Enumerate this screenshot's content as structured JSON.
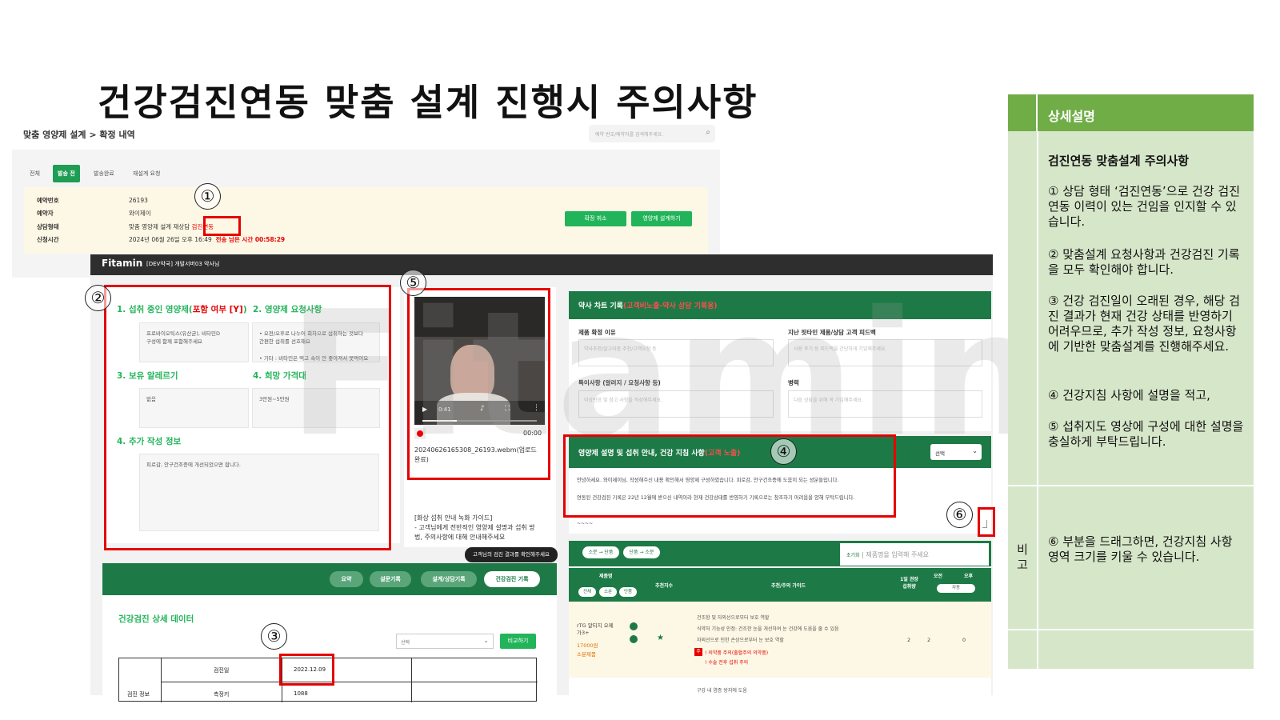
{
  "slide_title": "건강검진연동 맞춤 설계 진행시 주의사항",
  "admin": {
    "breadcrumb": "맞춤 영양제 설계 > 확정 내역",
    "search_placeholder": "예약 번호/예약자를 검색해주세요.",
    "tabs": [
      "전체",
      "발송 전",
      "발송완료",
      "재설계 요청"
    ],
    "rows": [
      {
        "label": "예약번호",
        "value": "26193"
      },
      {
        "label": "예약자",
        "value": "와이제이"
      },
      {
        "label": "상담형태",
        "value_prefix": "맞춤 영양제 설계 재상담",
        "value_highlight": "검진연동"
      },
      {
        "label": "신청시간",
        "value": "2024년 06월 26일 오후 16:49",
        "extra": "전송 남은 시간 00:58:29"
      }
    ],
    "cancel_btn": "확정 취소",
    "design_btn": "영양제 설계하기"
  },
  "fitamin": {
    "logo": "Fitamin",
    "subtitle": "[DEV약국] 개발서버03 약사님"
  },
  "watermark": "Fitamin",
  "left_panel": {
    "s1_title": "1. 섭취 중인 영양제(",
    "s1_title_red": "포함 여부 [Y]",
    "s1_title_end": ")",
    "s1_text": "프로바이오틱스(유산균), 비타민D\n구성에 함께 포함해주세요",
    "s2_title": "2. 영양제 요청사항",
    "s2_text": "• 오전/오후로 나누어 회차으로 섭취하는 것보다\n간편한 섭취를 선호해요\n\n• 기타 : 비타민은 먹고 속이 안 좋아져서 못먹어요",
    "s3_title": "3. 보유 알레르기",
    "s3_text": "없음",
    "s4_title": "4. 희망 가격대",
    "s4_text": "3만원~5만원",
    "s5_title": "4. 추가 작성 정보",
    "s5_text": "피로감, 안구건조증에 개선되었으면 합니다."
  },
  "video": {
    "time": "0:41",
    "rec_time": "00:00",
    "filename": "20240626165308_26193.webm(업로드완료)",
    "guide": "[화상 섭취 안내 녹화 가이드]\n- 고객님에게 전반적인 영양제 설명과 섭취 방법, 주의사항에 대해 안내해주세요"
  },
  "tooltip": "고객님의 검진 결과를 확인해주세요",
  "bottom_tabs": [
    "요약",
    "설문기록",
    "설계/상담기록",
    "건강검진 기록"
  ],
  "health": {
    "title": "건강검진 상세 데이터",
    "select": "선택",
    "compare_btn": "비교하기",
    "row1_label": "검진일",
    "row1_value": "2022.12.09",
    "row2_group": "검진 정보",
    "row2_label": "측정키",
    "row2_value": "1088"
  },
  "chart": {
    "title": "약사 차트 기록",
    "title_red": "(고객비노출-약사 상담 기록용)",
    "f1_label": "제품 확정 이유",
    "f1_ph": "약사추천/알고리즘 추천/고객요청 등",
    "f2_label": "지난 핏타민 제품/상담 고객 피드백",
    "f2_ph": "사용 후기 등 피드백을 간단하게 기입해주세요.",
    "f3_label": "특이사항 (알러지 / 요청사항 등)",
    "f3_ph": "이상반응 및 참고 사항을 작성해주세요.",
    "f4_label": "병력",
    "f4_ph": "다음 상담을 위해 꼭 기입해주세요."
  },
  "guide": {
    "title": "영양제 설명 및 섭취 안내, 건강 지침 사항",
    "title_red": "(고객 노출)",
    "select": "선택",
    "p1": "안녕하세요. 와이제이님, 작성해주신 내용 확인해서 영양제 구성하였습니다. 피로감, 안구건조증에 도움이 되는 성분들입니다.",
    "p2": "연동된 건강검진 기록은 22년 12월에 받으신 내역이라 현재 건강상태를 반영하기 기록으로는 참조하기 어려움을 양해 부탁드립니다.",
    "ellipsis": "~~~~"
  },
  "product": {
    "chip1": "소분 → 단품",
    "chip2": "단품 → 소분",
    "reset": "초기화",
    "search_ph": "제품명을 입력해 주세요",
    "headers": [
      "제품명",
      "추천지수",
      "추천/주의 가이드",
      "1일 권장 섭취량",
      "오전",
      "오후"
    ],
    "filters": [
      "전체",
      "소분",
      "단품"
    ],
    "auto": "자동",
    "item_name": "rTG 알티지 오메가3+",
    "item_price": "17000원",
    "item_type": "소분제품",
    "item_guide": [
      "건조함 및 자외선으로부터 보호 역할",
      "식약처 기능성 인정: 건조한 눈을 개선하여 눈 건강에 도움을 줄 수 있음",
      "자외선으로 인한 손상으로부터 눈 보호 역할"
    ],
    "item_warn1": "! 의약품 주의(출혈주의 의약품)",
    "item_warn2": "! 수술 전후 섭취 주의",
    "item_badge": "주",
    "item_qty": "2",
    "item_am": "2",
    "item_pm": "0",
    "next_guide": "구강 내 염증 방지에 도움"
  },
  "markers": [
    "①",
    "②",
    "③",
    "④",
    "⑤",
    "⑥"
  ],
  "right_table": {
    "header": "상세설명",
    "heading": "검진연동 맞춤설계 주의사항",
    "p1": "① 상담 형태 ‘검진연동’으로 건강 검진 연동 이력이 있는 건임을 인지할 수 있습니다.",
    "p2": "② 맞춤설계 요청사항과 건강검진 기록을 모두 확인해야 합니다.",
    "p3": "③ 건강 검진일이 오래된 경우, 해당 검진 결과가 현재 건강 상태를 반영하기 어려우므로, 추가 작성 정보, 요청사항에 기반한 맞춤설계를 진행해주세요.",
    "p4": "④ 건강지침 사항에 설명을 적고,",
    "p5": "⑤ 섭취지도 영상에 구성에 대한 설명을 충실하게 부탁드립니다.",
    "note_label": "비고",
    "note": "⑥ 부분을 드래그하면, 건강지침 사항 영역 크기를 키울 수 있습니다."
  }
}
